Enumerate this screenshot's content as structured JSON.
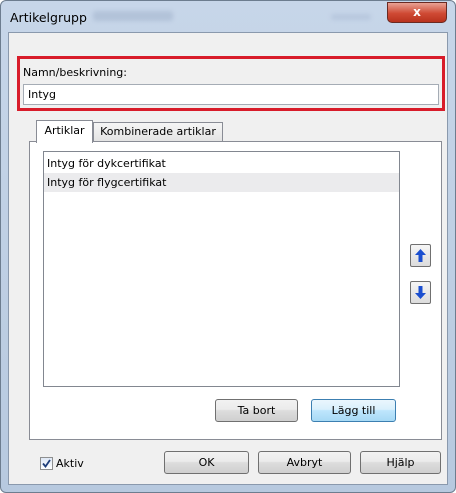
{
  "window": {
    "title": "Artikelgrupp",
    "close_label": "x"
  },
  "name_field": {
    "label": "Namn/beskrivning:",
    "value": "Intyg"
  },
  "tabs": [
    {
      "label": "Artiklar",
      "active": true
    },
    {
      "label": "Kombinerade artiklar",
      "active": false
    }
  ],
  "items": [
    {
      "label": "Intyg för dykcertifikat"
    },
    {
      "label": "Intyg för flygcertifikat"
    }
  ],
  "reorder": {
    "up_icon": "arrow-up-icon",
    "down_icon": "arrow-down-icon"
  },
  "list_actions": {
    "remove_label": "Ta bort",
    "add_label": "Lägg till"
  },
  "footer": {
    "active_label": "Aktiv",
    "active_checked": true,
    "ok_label": "OK",
    "cancel_label": "Avbryt",
    "help_label": "Hjälp"
  },
  "colors": {
    "highlight_border": "#d81c2a",
    "arrow_blue": "#1b4fd0",
    "close_red": "#cf4a34"
  }
}
